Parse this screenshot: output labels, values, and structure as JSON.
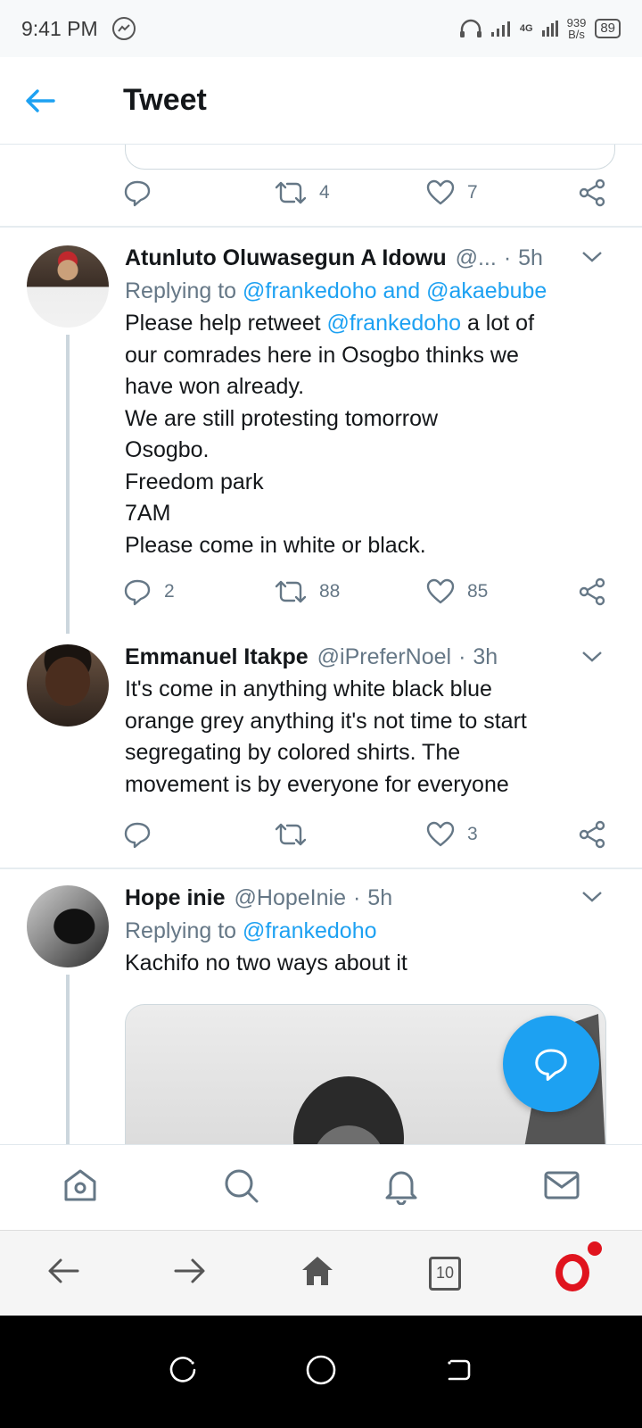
{
  "status_bar": {
    "time": "9:41 PM",
    "network": "4G",
    "speed_value": "939",
    "speed_unit": "B/s",
    "battery": "89"
  },
  "header": {
    "title": "Tweet"
  },
  "top_tweet_actions": {
    "reply_count": "",
    "retweet_count": "4",
    "like_count": "7"
  },
  "tweets": [
    {
      "name": "Atunluto Oluwasegun A Idowu",
      "handle": "@...",
      "age": "5h",
      "replying_label": "Replying to",
      "replying_handles": "@frankedoho and @akaebube",
      "text_mention": "@frankedoho",
      "text_before": "Please help retweet ",
      "text_after": " a lot of\nour comrades here in Osogbo thinks we\nhave won already.\nWe are still protesting tomorrow\nOsogbo.\nFreedom park\n7AM\nPlease come in white or black.",
      "reply_count": "2",
      "retweet_count": "88",
      "like_count": "85"
    },
    {
      "name": "Emmanuel Itakpe",
      "handle": "@iPreferNoel",
      "age": "3h",
      "text": "It's come in anything white black blue\norange grey anything it's not time to start\nsegregating by colored shirts. The\nmovement is by everyone for everyone",
      "reply_count": "",
      "retweet_count": "",
      "like_count": "3"
    },
    {
      "name": "Hope inie",
      "handle": "@HopeInie",
      "age": "5h",
      "replying_label": "Replying to",
      "replying_handles": "@frankedoho",
      "text": "Kachifo no two ways about it"
    }
  ],
  "colors": {
    "accent": "#1da1f2",
    "secondary_text": "#657786",
    "divider": "#e6ecf0",
    "opera_red": "#e0141e"
  },
  "browser_nav": {
    "tab_count": "10"
  }
}
